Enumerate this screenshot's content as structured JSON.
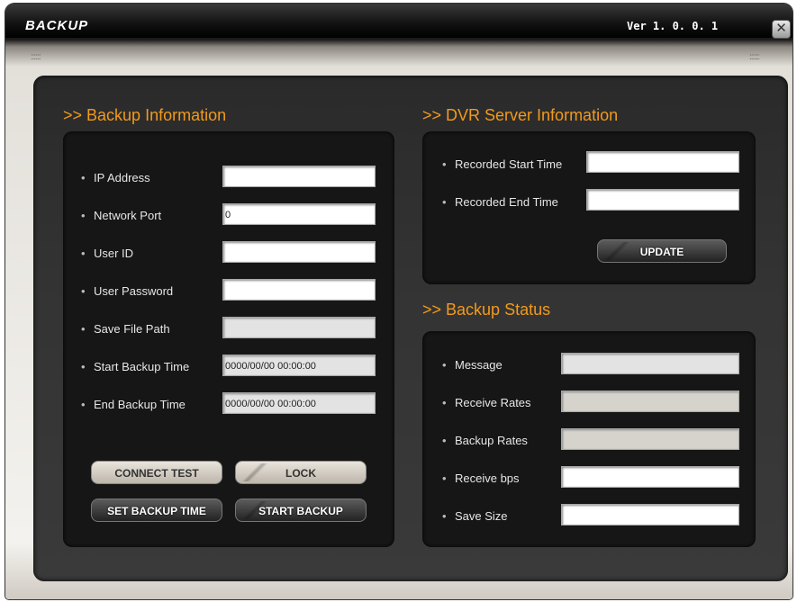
{
  "window": {
    "title": "BACKUP",
    "version": "Ver 1. 0. 0. 1",
    "close_glyph": "✕",
    "grip_left": "::::::",
    "grip_right": "::::::"
  },
  "backup_info": {
    "heading": ">> Backup Information",
    "fields": [
      {
        "label": "IP Address",
        "value": ""
      },
      {
        "label": "Network Port",
        "value": "0"
      },
      {
        "label": "User ID",
        "value": ""
      },
      {
        "label": "User Password",
        "value": ""
      },
      {
        "label": "Save File Path",
        "value": ""
      },
      {
        "label": "Start Backup Time",
        "value": "0000/00/00 00:00:00"
      },
      {
        "label": "End Backup Time",
        "value": "0000/00/00 00:00:00"
      }
    ],
    "buttons": {
      "connect_test": "CONNECT TEST",
      "lock": "LOCK",
      "set_backup_time": "SET BACKUP TIME",
      "start_backup": "START BACKUP"
    }
  },
  "dvr_info": {
    "heading": ">> DVR Server Information",
    "fields": [
      {
        "label": "Recorded Start Time",
        "value": ""
      },
      {
        "label": "Recorded End Time",
        "value": ""
      }
    ],
    "update_label": "UPDATE"
  },
  "backup_status": {
    "heading": ">> Backup Status",
    "fields": [
      {
        "label": "Message",
        "value": ""
      },
      {
        "label": "Receive Rates",
        "value": ""
      },
      {
        "label": "Backup Rates",
        "value": ""
      },
      {
        "label": "Receive bps",
        "value": ""
      },
      {
        "label": "Save Size",
        "value": ""
      }
    ]
  },
  "bullet": "•"
}
